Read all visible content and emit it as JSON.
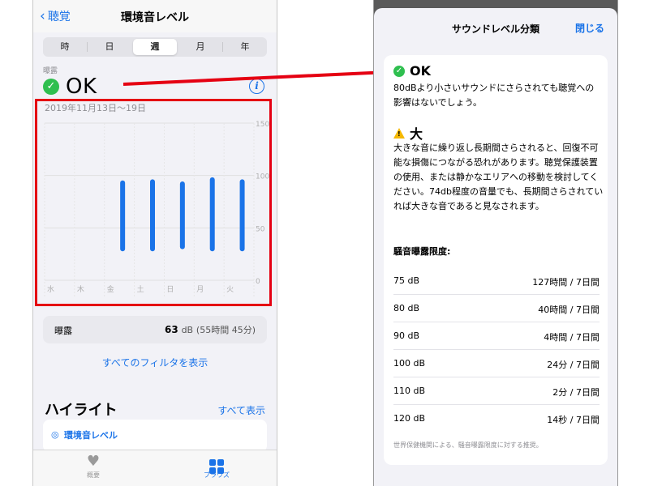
{
  "left": {
    "nav": {
      "back_label": "聴覚",
      "title": "環境音レベル"
    },
    "segments": [
      {
        "label": "時",
        "active": false
      },
      {
        "label": "日",
        "active": false
      },
      {
        "label": "週",
        "active": true
      },
      {
        "label": "月",
        "active": false
      },
      {
        "label": "年",
        "active": false
      }
    ],
    "exposure_label": "曝露",
    "status": "OK",
    "date_range": "2019年11月13日〜19日",
    "summary": {
      "label": "曝露",
      "value": "63",
      "unit": "dB",
      "detail": "(55時間 45分)"
    },
    "filters_link": "すべてのフィルタを表示",
    "highlights": {
      "title": "ハイライト",
      "show_all": "すべて表示",
      "card_label": "環境音レベル"
    },
    "tabs": [
      {
        "label": "概要"
      },
      {
        "label": "ブラウズ"
      }
    ]
  },
  "right": {
    "title": "サウンドレベル分類",
    "close_label": "閉じる",
    "ok": {
      "heading": "OK",
      "description": "80dBより小さいサウンドにさらされても聴覚への影響はないでしょう。"
    },
    "loud": {
      "heading": "大",
      "description": "大きな音に繰り返し長期間さらされると、回復不可能な損傷につながる恐れがあります。聴覚保護装置の使用、または静かなエリアへの移動を検討してください。74db程度の音量でも、長期間さらされていれば大きな音であると見なされます。"
    },
    "limits_title": "騒音曝露限度:",
    "limits": [
      {
        "db": "75 dB",
        "time": "127時間 / 7日間"
      },
      {
        "db": "80 dB",
        "time": "40時間 / 7日間"
      },
      {
        "db": "90 dB",
        "time": "4時間 / 7日間"
      },
      {
        "db": "100 dB",
        "time": "24分 / 7日間"
      },
      {
        "db": "110 dB",
        "time": "2分 / 7日間"
      },
      {
        "db": "120 dB",
        "time": "14秒 / 7日間"
      }
    ],
    "footnote": "世界保健機関による、騒音曝露限度に対する推奨。"
  },
  "colors": {
    "accent": "#1a73e8",
    "ok_green": "#2fbf4f",
    "warning": "#f5b800",
    "annotation_red": "#e50012"
  },
  "chart_data": {
    "type": "bar",
    "categories": [
      "水",
      "木",
      "金",
      "土",
      "日",
      "月",
      "火"
    ],
    "series": [
      {
        "low": [
          null,
          null,
          30,
          30,
          32,
          30,
          30
        ],
        "high": [
          null,
          null,
          93,
          94,
          92,
          96,
          94
        ]
      }
    ],
    "yticks": [
      "150",
      "100",
      "50",
      "0"
    ],
    "ylim": [
      0,
      150
    ],
    "grid": true
  }
}
